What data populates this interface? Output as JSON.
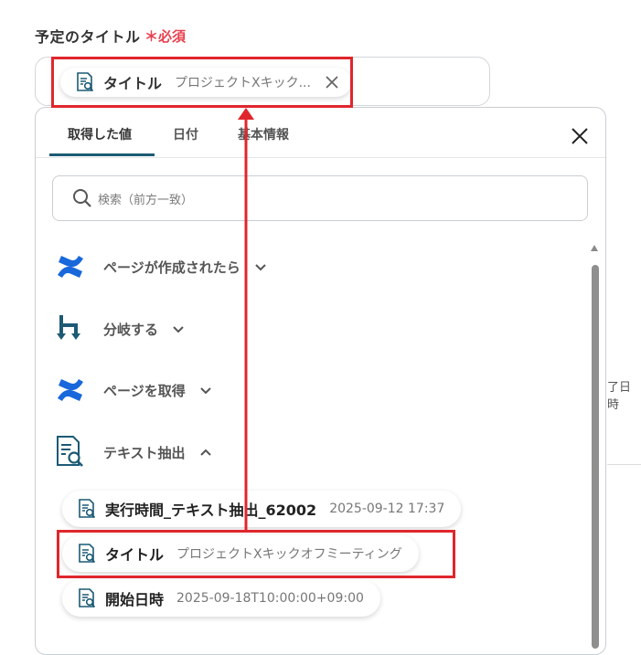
{
  "field": {
    "label": "予定のタイトル",
    "required_mark": "＊必須",
    "chip": {
      "name": "タイトル",
      "value": "プロジェクトXキック..."
    }
  },
  "panel": {
    "tabs": [
      {
        "label": "取得した値",
        "active": true
      },
      {
        "label": "日付"
      },
      {
        "label": "基本情報"
      }
    ],
    "search": {
      "placeholder": "検索（前方一致）"
    },
    "sections": [
      {
        "label": "ページが作成されたら",
        "icon": "confluence-icon",
        "expanded": false
      },
      {
        "label": "分岐する",
        "icon": "branch-icon",
        "expanded": false
      },
      {
        "label": "ページを取得",
        "icon": "confluence-icon",
        "expanded": false
      },
      {
        "label": "テキスト抽出",
        "icon": "text-extract-icon",
        "expanded": true
      }
    ],
    "values": [
      {
        "name": "実行時間_テキスト抽出_62002",
        "value": "2025-09-12 17:37"
      },
      {
        "name": "タイトル",
        "value": "プロジェクトXキックオフミーティング"
      },
      {
        "name": "開始日時",
        "value": "2025-09-18T10:00:00+09:00"
      }
    ]
  },
  "background": {
    "partial_text": "了日時"
  },
  "colors": {
    "accent": "#1c5a74",
    "required": "#e8414e",
    "highlight": "#e0262d",
    "confluence": "#1868db",
    "branch": "#1c5a74"
  }
}
